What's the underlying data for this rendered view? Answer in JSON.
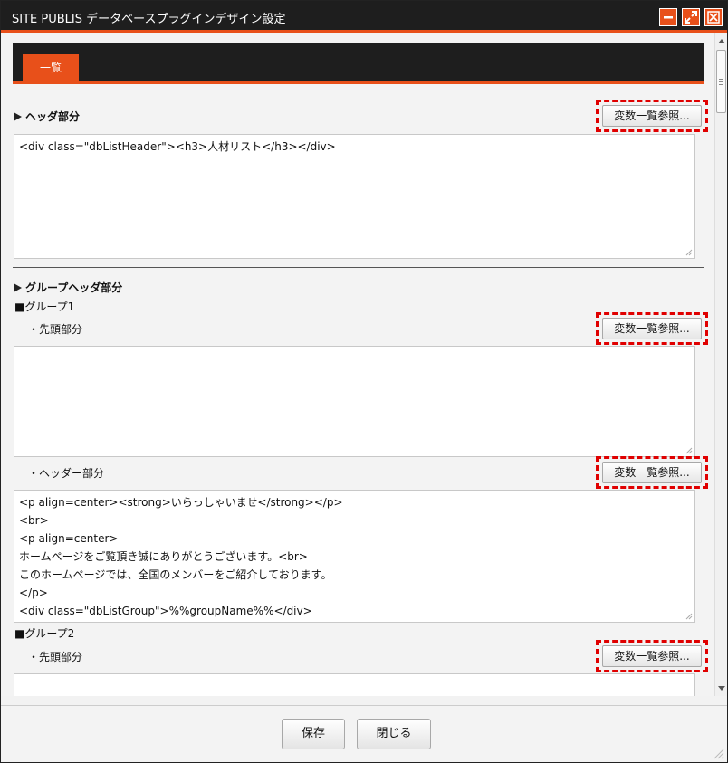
{
  "window": {
    "title": "SITE PUBLIS データベースプラグインデザイン設定"
  },
  "tabs": [
    {
      "label": "一覧"
    }
  ],
  "header_section": {
    "title": "ヘッダ部分",
    "ref_button": "変数一覧参照...",
    "code": "<div class=\"dbListHeader\"><h3>人材リスト</h3></div>"
  },
  "group_header_section": {
    "title": "グループヘッダ部分",
    "groups": [
      {
        "title": "■グループ1",
        "lead_label": "・先頭部分",
        "lead_ref_button": "変数一覧参照...",
        "lead_code": "",
        "header_label": "・ヘッダー部分",
        "header_ref_button": "変数一覧参照...",
        "header_code": "<p align=center><strong>いらっしゃいませ</strong></p>\n<br>\n<p align=center>\nホームページをご覧頂き誠にありがとうございます。<br>\nこのホームページでは、全国のメンバーをご紹介しております。\n</p>\n<div class=\"dbListGroup\">%%groupName%%</div>"
      },
      {
        "title": "■グループ2",
        "lead_label": "・先頭部分",
        "lead_ref_button": "変数一覧参照...",
        "lead_code": ""
      }
    ]
  },
  "footer": {
    "save_label": "保存",
    "close_label": "閉じる"
  },
  "colors": {
    "accent": "#e8501a",
    "titlebar": "#1e1e1e",
    "highlight_dash": "#e00000"
  },
  "icons": {
    "minimize": "minimize-icon",
    "maximize": "maximize-icon",
    "close": "close-icon"
  }
}
